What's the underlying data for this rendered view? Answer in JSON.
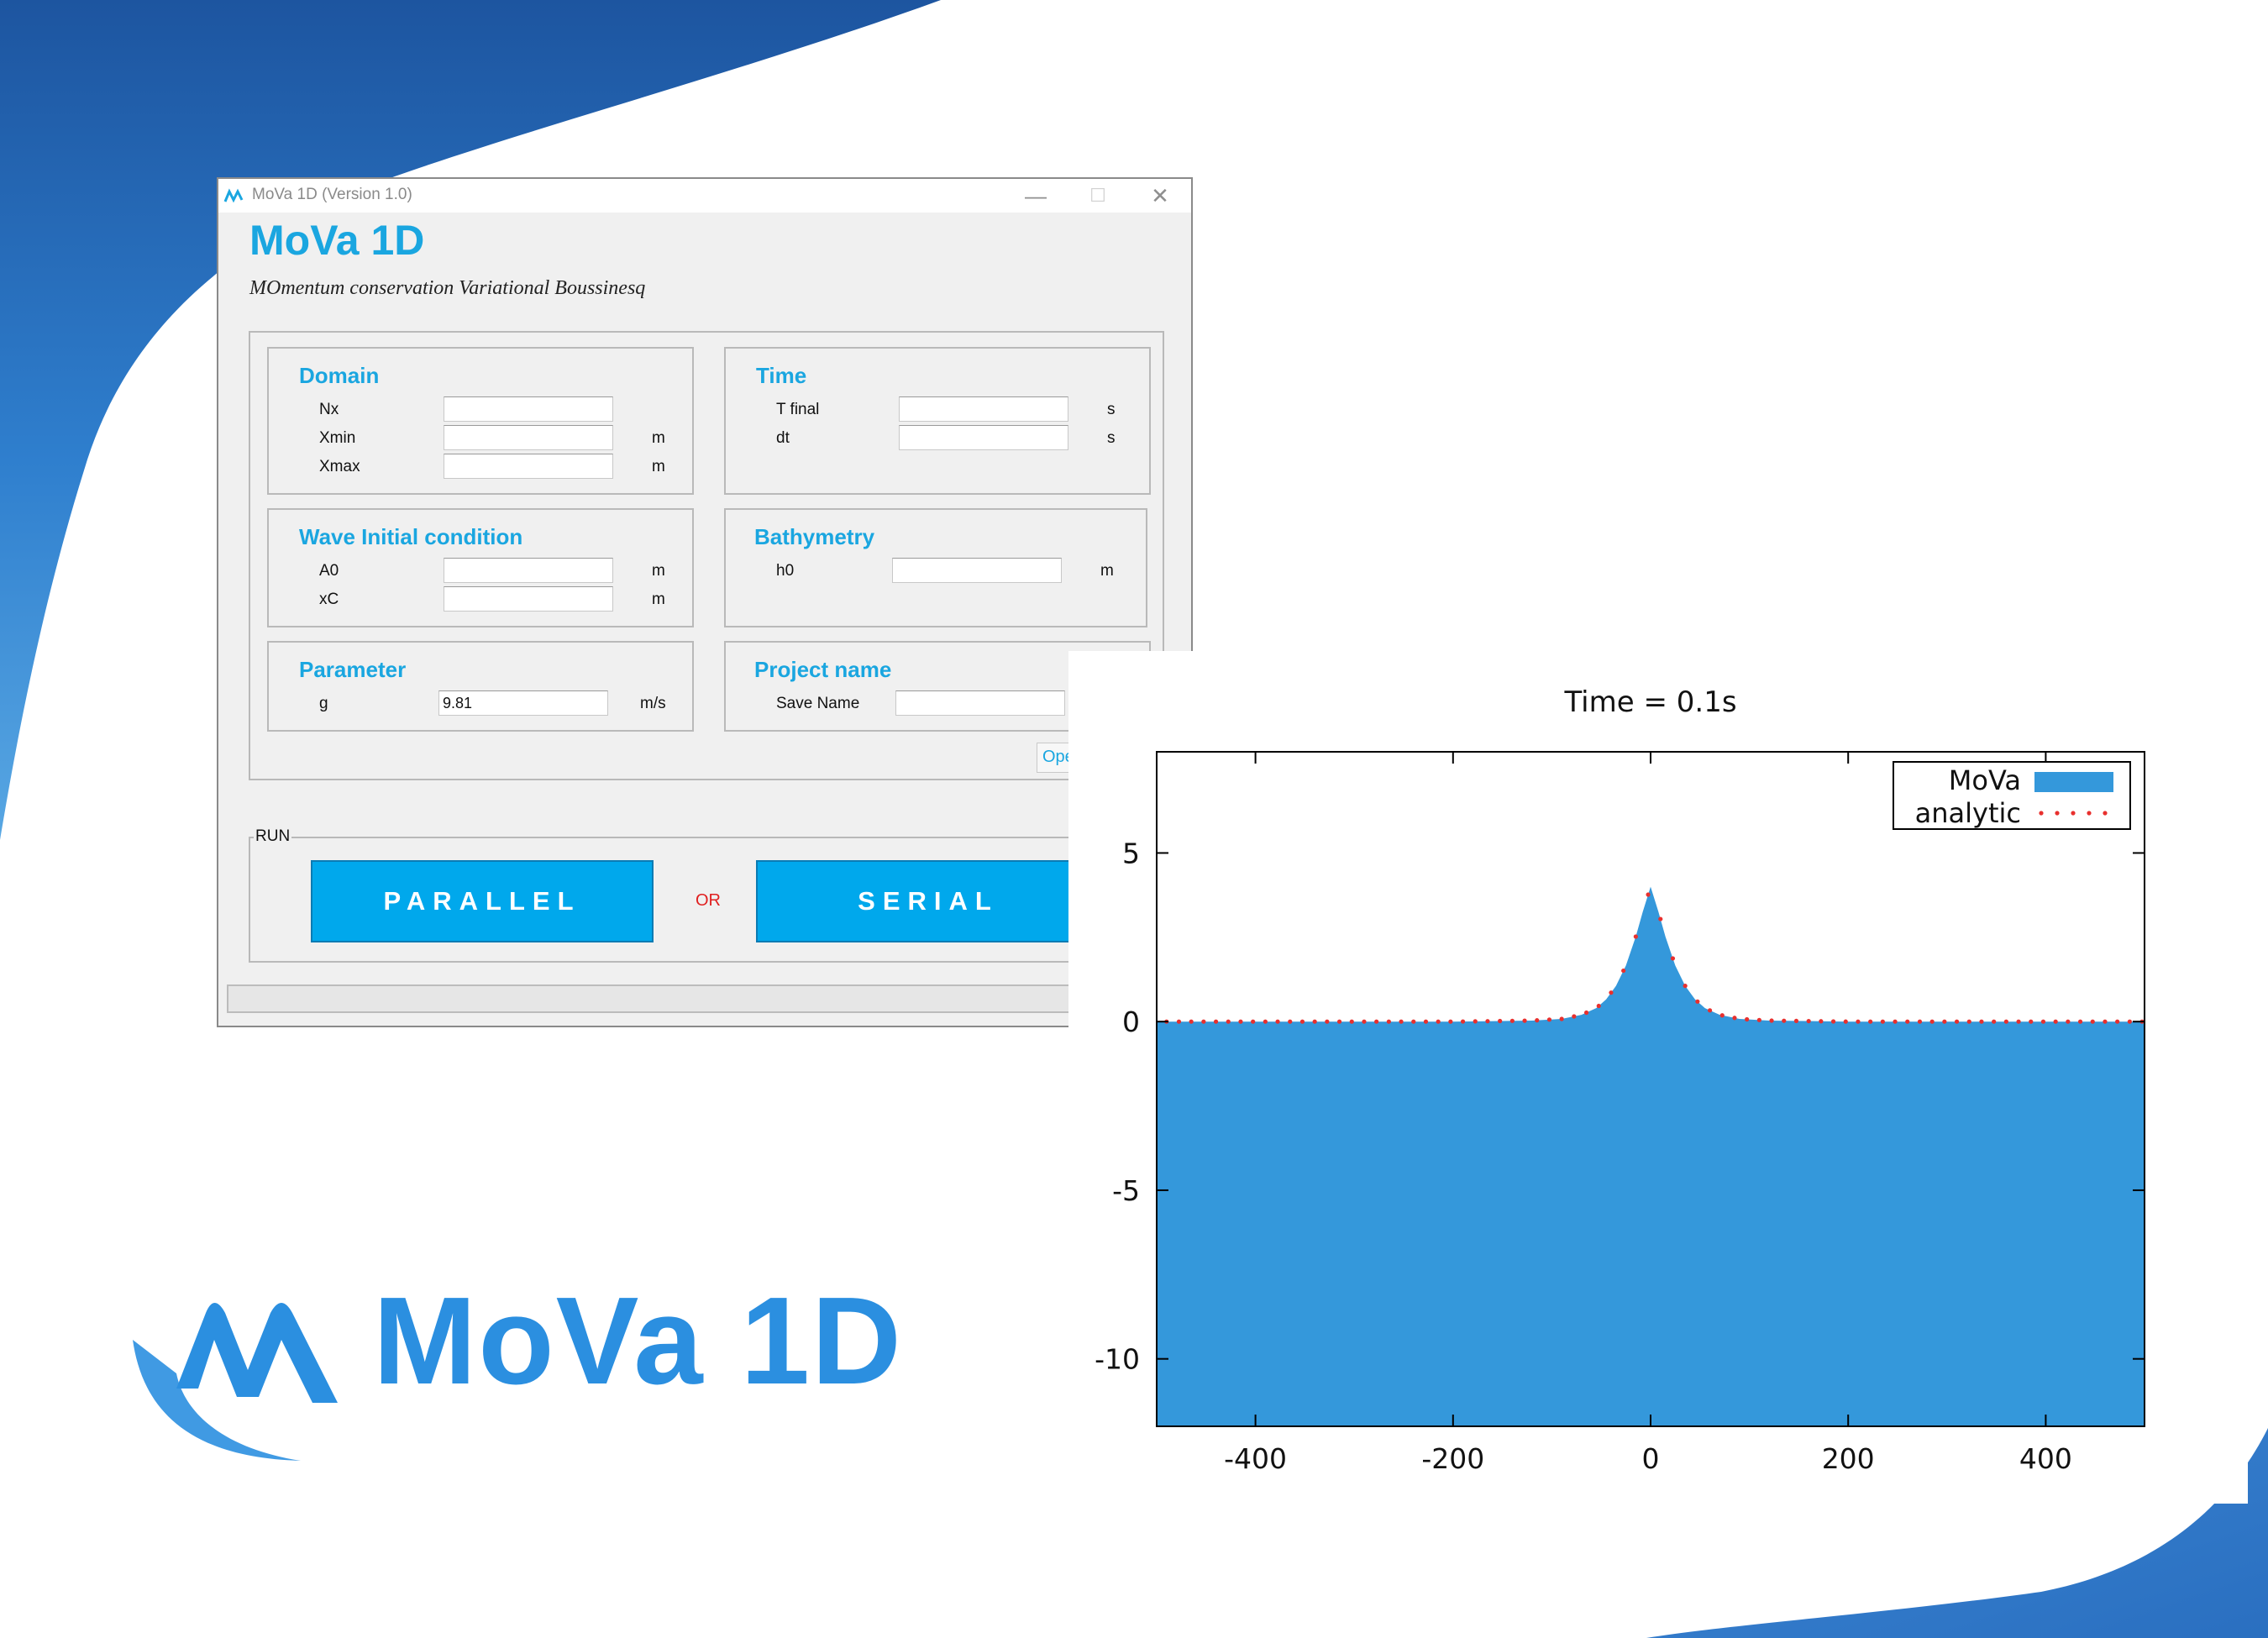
{
  "window": {
    "title": "MoVa 1D (Version 1.0)",
    "heading": "MoVa 1D",
    "subtitle": "MOmentum conservation Variational Boussinesq",
    "minimize_glyph": "—",
    "maximize_glyph": "☐",
    "close_glyph": "✕"
  },
  "domain": {
    "title": "Domain",
    "fields": [
      {
        "label": "Nx",
        "value": "",
        "unit": ""
      },
      {
        "label": "Xmin",
        "value": "",
        "unit": "m"
      },
      {
        "label": "Xmax",
        "value": "",
        "unit": "m"
      }
    ]
  },
  "time": {
    "title": "Time",
    "fields": [
      {
        "label": "T final",
        "value": "",
        "unit": "s"
      },
      {
        "label": "dt",
        "value": "",
        "unit": "s"
      }
    ]
  },
  "wave": {
    "title": "Wave Initial condition",
    "fields": [
      {
        "label": "A0",
        "value": "",
        "unit": "m"
      },
      {
        "label": "xC",
        "value": "",
        "unit": "m"
      }
    ]
  },
  "bathymetry": {
    "title": "Bathymetry",
    "fields": [
      {
        "label": "h0",
        "value": "",
        "unit": "m"
      }
    ]
  },
  "parameter": {
    "title": "Parameter",
    "fields": [
      {
        "label": "g",
        "value": "9.81",
        "unit": "m/s"
      }
    ]
  },
  "project": {
    "title": "Project name",
    "fields": [
      {
        "label": "Save Name",
        "value": "",
        "unit": ""
      }
    ],
    "open_button": "Ope"
  },
  "run": {
    "label": "RUN",
    "parallel_button": "PARALLEL",
    "or_text": "OR",
    "serial_button": "SERIAL",
    "progress": 0
  },
  "logo": {
    "text": "MoVa 1D"
  },
  "colors": {
    "accent": "#1aa6e0",
    "button": "#00a8ec",
    "fill": "#3498db",
    "analytic": "#e8302e",
    "logo": "#2b8fe0"
  },
  "chart_data": {
    "type": "area",
    "title": "Time = 0.1s",
    "xlabel": "",
    "ylabel": "",
    "xlim": [
      -500,
      500
    ],
    "ylim": [
      -12,
      8
    ],
    "xticks": [
      -400,
      -200,
      0,
      200,
      400
    ],
    "yticks": [
      5,
      0,
      -5,
      -10
    ],
    "grid": false,
    "legend": "top-right",
    "series": [
      {
        "name": "MoVa",
        "style": "filled",
        "x": [
          -500,
          -200,
          -120,
          -90,
          -70,
          -55,
          -45,
          -35,
          -25,
          -15,
          -8,
          0,
          8,
          15,
          25,
          35,
          45,
          55,
          70,
          90,
          120,
          200,
          500
        ],
        "values": [
          0,
          0,
          0.03,
          0.08,
          0.2,
          0.4,
          0.66,
          1.06,
          1.66,
          2.52,
          3.25,
          4.0,
          3.25,
          2.52,
          1.66,
          1.06,
          0.66,
          0.4,
          0.2,
          0.08,
          0.03,
          0,
          0
        ]
      },
      {
        "name": "analytic",
        "style": "dotted",
        "x": [
          -500,
          -200,
          -120,
          -90,
          -70,
          -55,
          -45,
          -35,
          -25,
          -15,
          -8,
          0,
          8,
          15,
          25,
          35,
          45,
          55,
          70,
          90,
          120,
          200,
          500
        ],
        "values": [
          0,
          0,
          0.03,
          0.08,
          0.2,
          0.4,
          0.66,
          1.06,
          1.66,
          2.52,
          3.25,
          4.0,
          3.25,
          2.52,
          1.66,
          1.06,
          0.66,
          0.4,
          0.2,
          0.08,
          0.03,
          0,
          0
        ]
      }
    ]
  }
}
